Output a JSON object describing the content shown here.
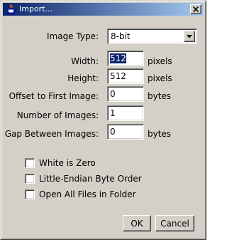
{
  "window": {
    "title": "Import...",
    "icon": "java-cup-icon"
  },
  "form": {
    "image_type_label": "Image Type:",
    "image_type_value": "8-bit",
    "width_label": "Width:",
    "width_value": "512",
    "width_unit": "pixels",
    "height_label": "Height:",
    "height_value": "512",
    "height_unit": "pixels",
    "offset_label": "Offset to First Image:",
    "offset_value": "0",
    "offset_unit": "bytes",
    "num_images_label": "Number of Images:",
    "num_images_value": "1",
    "gap_label": "Gap Between Images:",
    "gap_value": "0",
    "gap_unit": "bytes"
  },
  "options": [
    {
      "label": "White is Zero",
      "checked": false
    },
    {
      "label": "Little-Endian Byte Order",
      "checked": false
    },
    {
      "label": "Open All Files in Folder",
      "checked": false
    }
  ],
  "buttons": {
    "ok": "OK",
    "cancel": "Cancel"
  },
  "colors": {
    "face": "#d4d0c8",
    "title_start": "#0a246a",
    "title_end": "#a6caf0",
    "selection": "#0a246a"
  }
}
